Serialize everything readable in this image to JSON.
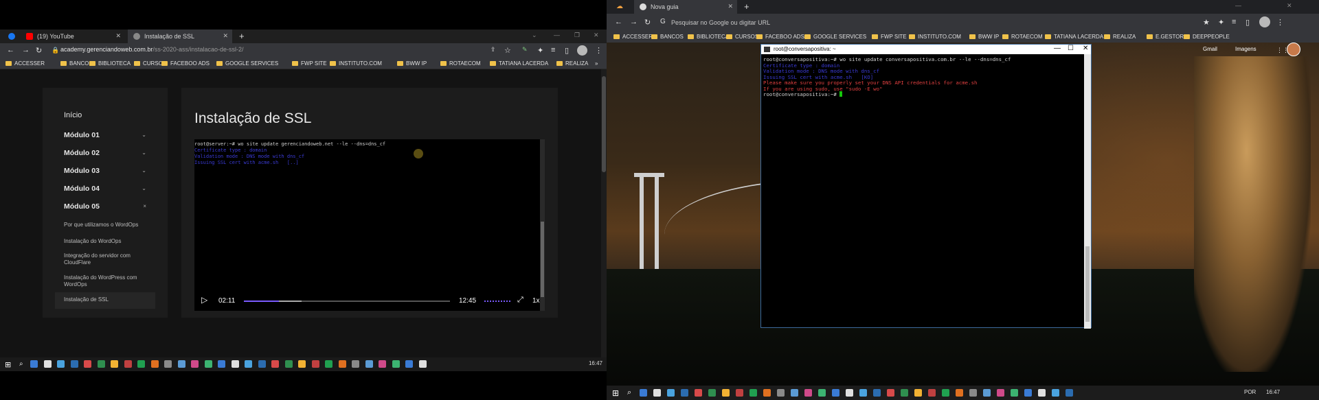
{
  "left_browser": {
    "tabs": [
      {
        "label": "(19) YouTube"
      },
      {
        "label": "Instalação de SSL"
      }
    ],
    "new_tab": "+",
    "url_domain": "academy.gerenciandoweb.com.br",
    "url_path": "/ss-2020-ass/instalacao-de-ssl-2/",
    "bookmarks": [
      "ACCESSER",
      "BANCOS",
      "BIBLIOTECA",
      "CURSOS",
      "FACEBOO ADS",
      "GOOGLE SERVICES",
      "FWP SITE",
      "INSTITUTO.COM",
      "BWW IP",
      "ROTAECOM",
      "TATIANA LACERDA",
      "REALIZA"
    ],
    "bookmarks_more": "»"
  },
  "course": {
    "start": "Início",
    "modules": [
      {
        "label": "Módulo 01",
        "chev": "⌄"
      },
      {
        "label": "Módulo 02",
        "chev": "⌄"
      },
      {
        "label": "Módulo 03",
        "chev": "⌄"
      },
      {
        "label": "Módulo 04",
        "chev": "⌄"
      },
      {
        "label": "Módulo 05",
        "chev": "×"
      }
    ],
    "lessons": [
      "Por que utilizamos o WordOps",
      "Instalação do WordOps",
      "Integração do servidor com CloudFlare",
      "Instalação do WordPress com WordOps",
      "Instalação de SSL"
    ],
    "page_title": "Instalação de SSL"
  },
  "video": {
    "terminal": [
      {
        "text": "root@server:~# wo site update gerenciandoweb.net --le --dns=dns_cf",
        "color": "#cfcfcf"
      },
      {
        "text": "Certificate type : domain",
        "color": "#3b3bd6"
      },
      {
        "text": "Validation mode : DNS mode with dns_cf",
        "color": "#3b3bd6"
      },
      {
        "text": "Issuing SSL cert with acme.sh   [..]",
        "color": "#3b3bd6"
      }
    ],
    "current_time": "02:11",
    "duration": "12:45",
    "speed": "1x",
    "progress_played": 0.17,
    "progress_buffered": 0.28
  },
  "left_taskbar": {
    "clock": "16:47"
  },
  "right_browser": {
    "tab_label": "Nova guia",
    "new_tab": "+",
    "search_placeholder": "Pesquisar no Google ou digitar URL",
    "bookmarks": [
      "ACCESSER",
      "BANCOS",
      "BIBLIOTECA",
      "CURSOS",
      "FACEBOO ADS",
      "GOOGLE SERVICES",
      "FWP SITE",
      "INSTITUTO.COM",
      "BWW IP",
      "ROTAECOM",
      "TATIANA LACERDA",
      "REALIZA",
      "E.GESTOR",
      "DEEPPEOPLE"
    ],
    "gmail": "Gmail",
    "images": "Imagens"
  },
  "ssh_terminal": {
    "title": "root@conversapositiva: ~",
    "lines": [
      {
        "text": "root@conversapositiva:~# wo site update conversapositiva.com.br --le --dns=dns_cf",
        "color": "#d4d4d4"
      },
      {
        "text": "Certificate type : domain",
        "color": "#3b3bd6"
      },
      {
        "text": "Validation mode : DNS mode with dns_cf",
        "color": "#3b3bd6"
      },
      {
        "text": "Issuing SSL cert with acme.sh   [KO]",
        "color": "#3b3bd6"
      },
      {
        "text": "Please make sure you properly set your DNS API credentials for acme.sh",
        "color": "#e04040"
      },
      {
        "text": "If you are using sudo, use \"sudo -E wo\"",
        "color": "#e04040"
      },
      {
        "text": "root@conversapositiva:~# ",
        "color": "#d4d4d4"
      }
    ]
  },
  "right_taskbar": {
    "lang": "POR",
    "clock": "16:47"
  }
}
